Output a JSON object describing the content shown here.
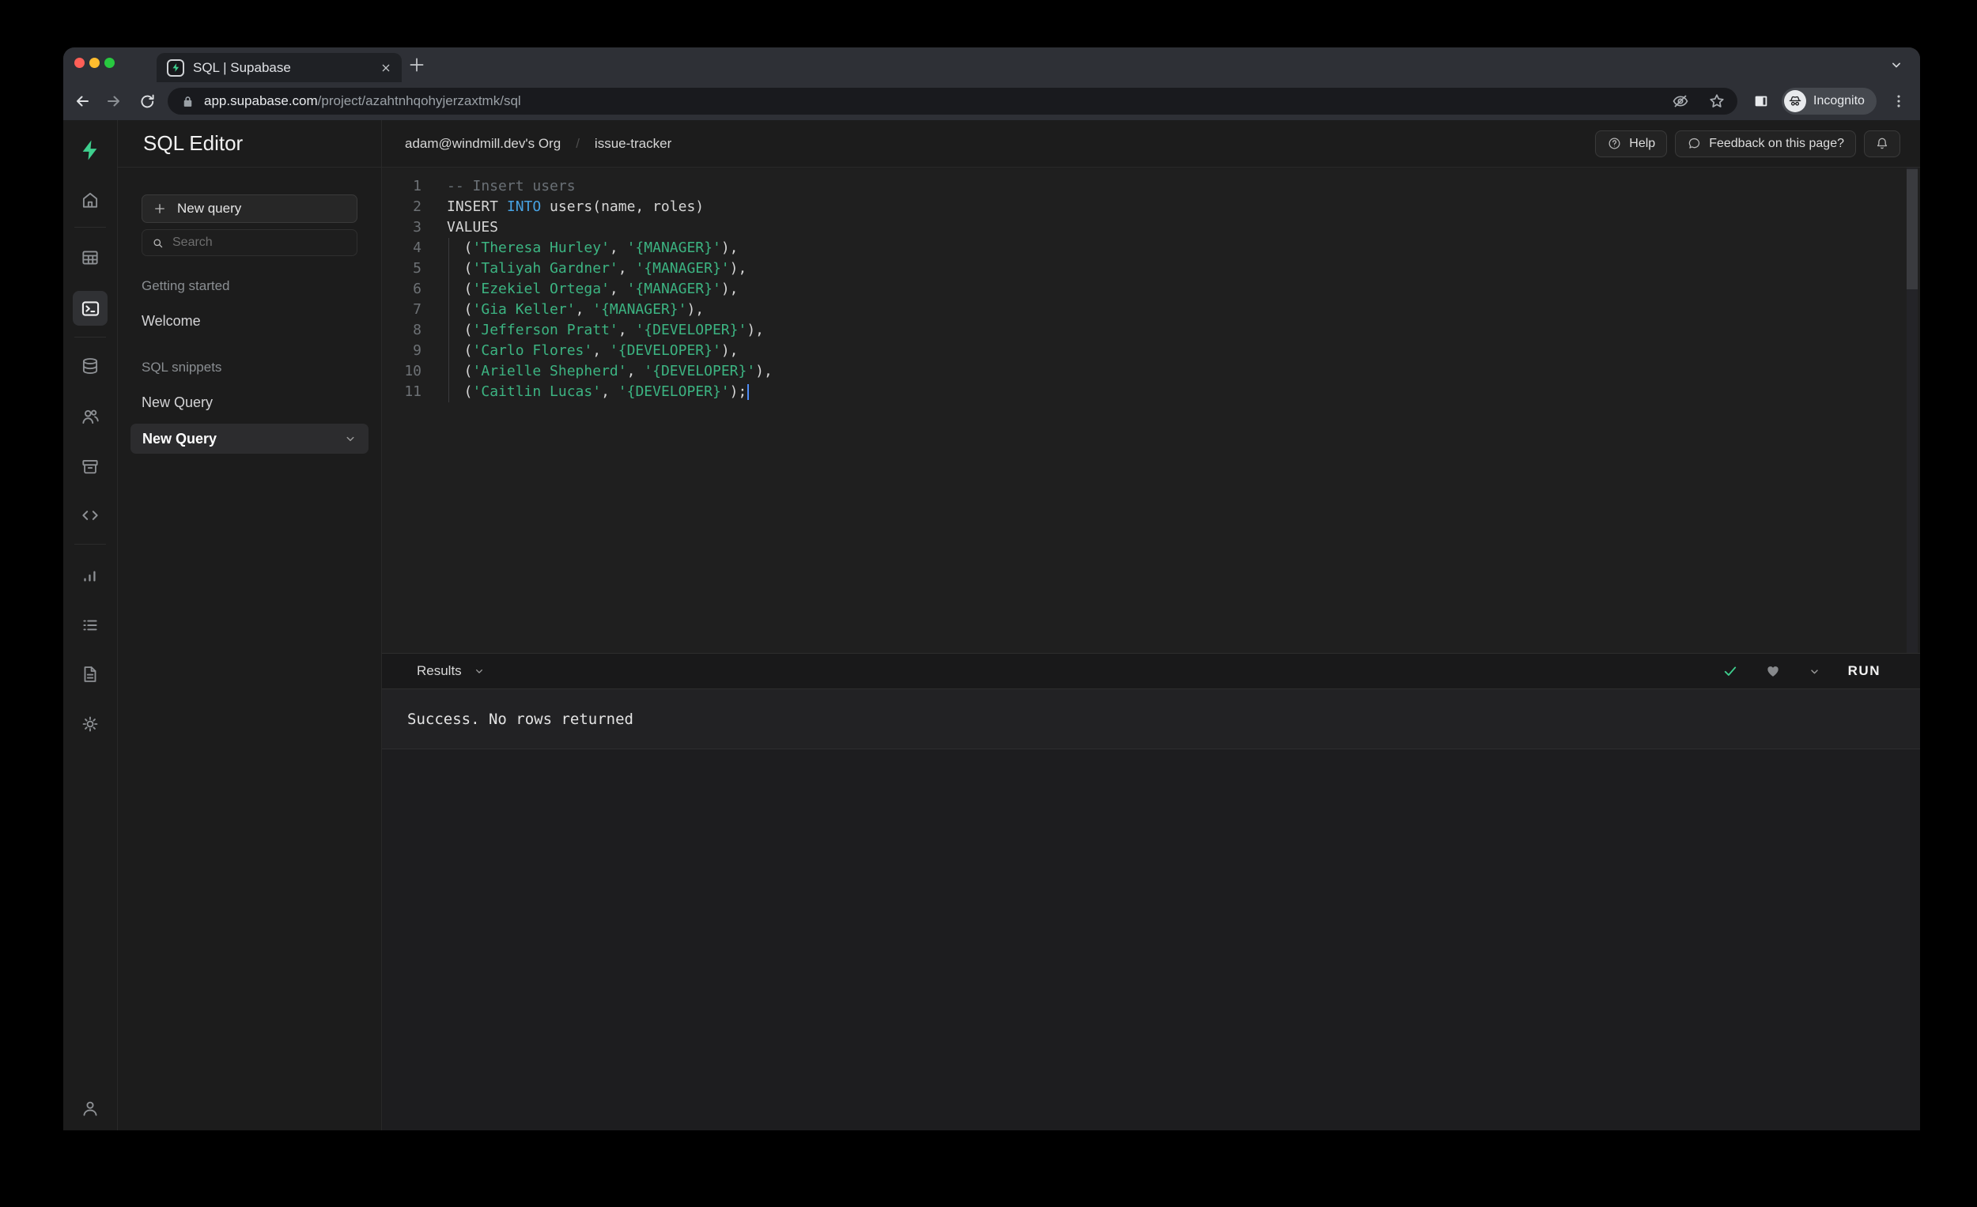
{
  "browser": {
    "tab_title": "SQL | Supabase",
    "url_host": "app.supabase.com",
    "url_path": "/project/azahtnhqohyjerzaxtmk/sql",
    "incognito_label": "Incognito"
  },
  "rail": {
    "icons": [
      "supabase-logo",
      "home",
      "table-editor",
      "sql-editor",
      "database",
      "authentication",
      "storage",
      "edge-functions",
      "reports",
      "logs",
      "api-docs",
      "settings",
      "account"
    ],
    "active": "sql-editor"
  },
  "sidebar": {
    "title": "SQL Editor",
    "new_query_button": "New query",
    "search_placeholder": "Search",
    "sections": [
      {
        "label": "Getting started",
        "items": [
          {
            "label": "Welcome",
            "selected": false
          }
        ]
      },
      {
        "label": "SQL snippets",
        "items": [
          {
            "label": "New Query",
            "selected": false
          },
          {
            "label": "New Query",
            "selected": true
          }
        ]
      }
    ]
  },
  "header": {
    "breadcrumb": {
      "org": "adam@windmill.dev's Org",
      "separator": "/",
      "project": "issue-tracker"
    },
    "help_button": "Help",
    "feedback_button": "Feedback on this page?"
  },
  "editor": {
    "lines": [
      {
        "n": "1",
        "tokens": [
          {
            "t": "-- Insert users",
            "c": "comment"
          }
        ]
      },
      {
        "n": "2",
        "tokens": [
          {
            "t": "INSERT ",
            "c": "plain"
          },
          {
            "t": "INTO",
            "c": "keyword"
          },
          {
            "t": " users(name, roles)",
            "c": "plain"
          }
        ]
      },
      {
        "n": "3",
        "tokens": [
          {
            "t": "VALUES",
            "c": "plain"
          }
        ]
      },
      {
        "n": "4",
        "tokens": [
          {
            "t": "  (",
            "c": "plain"
          },
          {
            "t": "'Theresa Hurley'",
            "c": "string"
          },
          {
            "t": ", ",
            "c": "plain"
          },
          {
            "t": "'{MANAGER}'",
            "c": "string"
          },
          {
            "t": "),",
            "c": "plain"
          }
        ]
      },
      {
        "n": "5",
        "tokens": [
          {
            "t": "  (",
            "c": "plain"
          },
          {
            "t": "'Taliyah Gardner'",
            "c": "string"
          },
          {
            "t": ", ",
            "c": "plain"
          },
          {
            "t": "'{MANAGER}'",
            "c": "string"
          },
          {
            "t": "),",
            "c": "plain"
          }
        ]
      },
      {
        "n": "6",
        "tokens": [
          {
            "t": "  (",
            "c": "plain"
          },
          {
            "t": "'Ezekiel Ortega'",
            "c": "string"
          },
          {
            "t": ", ",
            "c": "plain"
          },
          {
            "t": "'{MANAGER}'",
            "c": "string"
          },
          {
            "t": "),",
            "c": "plain"
          }
        ]
      },
      {
        "n": "7",
        "tokens": [
          {
            "t": "  (",
            "c": "plain"
          },
          {
            "t": "'Gia Keller'",
            "c": "string"
          },
          {
            "t": ", ",
            "c": "plain"
          },
          {
            "t": "'{MANAGER}'",
            "c": "string"
          },
          {
            "t": "),",
            "c": "plain"
          }
        ]
      },
      {
        "n": "8",
        "tokens": [
          {
            "t": "  (",
            "c": "plain"
          },
          {
            "t": "'Jefferson Pratt'",
            "c": "string"
          },
          {
            "t": ", ",
            "c": "plain"
          },
          {
            "t": "'{DEVELOPER}'",
            "c": "string"
          },
          {
            "t": "),",
            "c": "plain"
          }
        ]
      },
      {
        "n": "9",
        "tokens": [
          {
            "t": "  (",
            "c": "plain"
          },
          {
            "t": "'Carlo Flores'",
            "c": "string"
          },
          {
            "t": ", ",
            "c": "plain"
          },
          {
            "t": "'{DEVELOPER}'",
            "c": "string"
          },
          {
            "t": "),",
            "c": "plain"
          }
        ]
      },
      {
        "n": "10",
        "tokens": [
          {
            "t": "  (",
            "c": "plain"
          },
          {
            "t": "'Arielle Shepherd'",
            "c": "string"
          },
          {
            "t": ", ",
            "c": "plain"
          },
          {
            "t": "'{DEVELOPER}'",
            "c": "string"
          },
          {
            "t": "),",
            "c": "plain"
          }
        ]
      },
      {
        "n": "11",
        "cursor": true,
        "tokens": [
          {
            "t": "  (",
            "c": "plain"
          },
          {
            "t": "'Caitlin Lucas'",
            "c": "string"
          },
          {
            "t": ", ",
            "c": "plain"
          },
          {
            "t": "'{DEVELOPER}'",
            "c": "string"
          },
          {
            "t": ");",
            "c": "plain"
          }
        ]
      }
    ]
  },
  "results": {
    "tab_label": "Results",
    "run_button": "RUN",
    "message": "Success. No rows returned"
  },
  "colors": {
    "accent_green": "#3ecf8e",
    "string_green": "#3cb482",
    "keyword_blue": "#47a2e2",
    "traffic_red": "#ff5f57",
    "traffic_yellow": "#febc2e",
    "traffic_green": "#28c840"
  }
}
